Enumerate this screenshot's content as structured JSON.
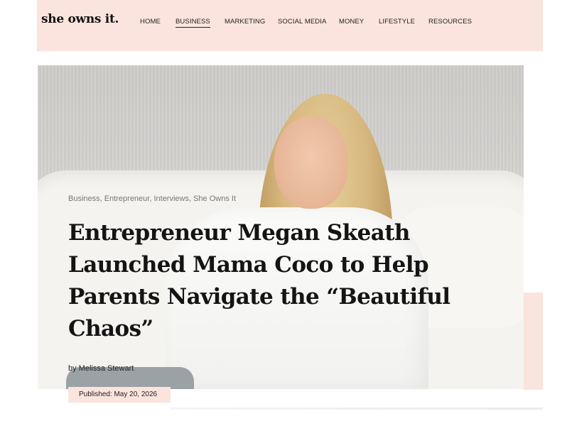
{
  "site": {
    "logo": "she owns it."
  },
  "nav": [
    {
      "label": "HOME"
    },
    {
      "label": "BUSINESS",
      "active": true
    },
    {
      "label": "MARKETING"
    },
    {
      "label": "SOCIAL MEDIA"
    },
    {
      "label": "MONEY"
    },
    {
      "label": "LIFESTYLE"
    },
    {
      "label": "RESOURCES"
    }
  ],
  "article": {
    "categories": "Business, Entrepreneur, Interviews, She Owns It",
    "title": "Entrepreneur Megan Skeath Launched Mama Coco to Help Parents Navigate the “Beautiful Chaos”",
    "byline": "by Melissa Stewart",
    "published": "Published: May 20, 2026"
  },
  "colors": {
    "accent": "#fbe4dd",
    "text": "#141414"
  }
}
